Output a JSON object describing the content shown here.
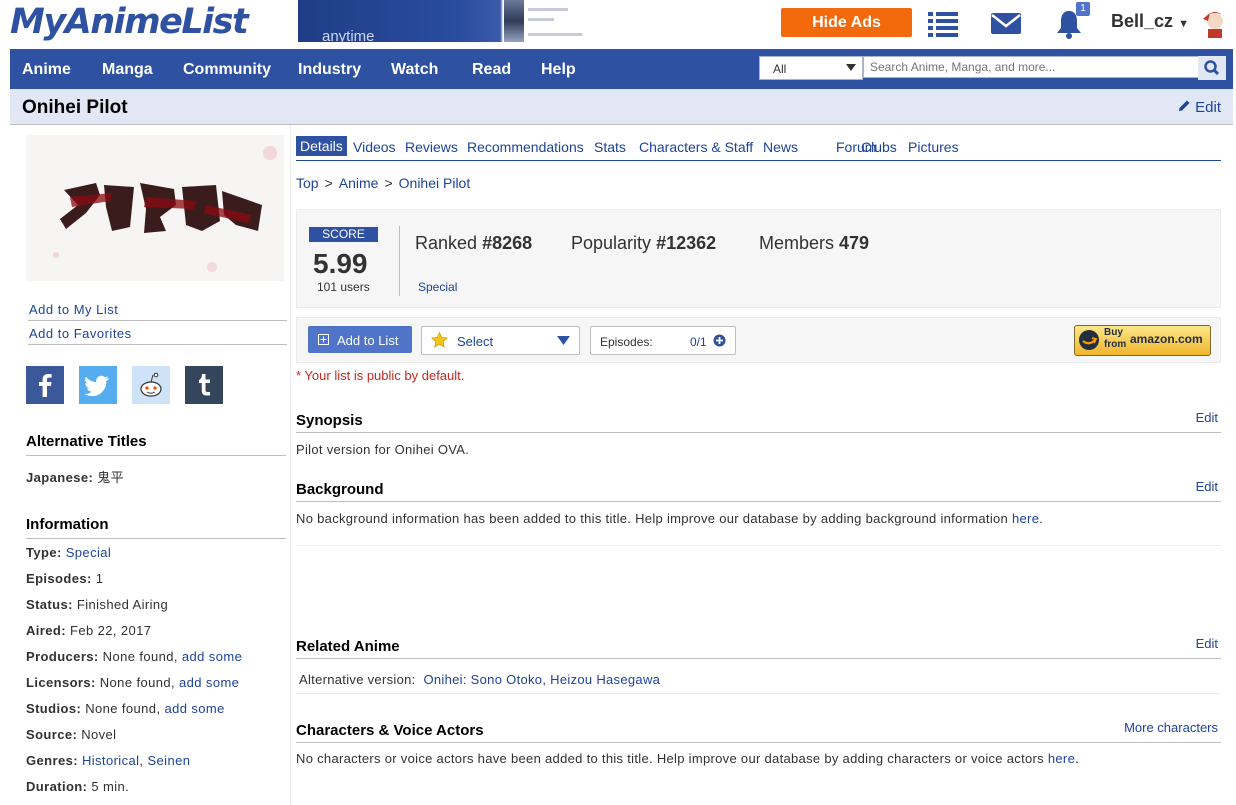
{
  "header": {
    "logo": "MyAnimeList",
    "ad_text": "anytime",
    "hide_ads_label": "Hide Ads",
    "username": "Bell_cz",
    "notification_count": "1"
  },
  "nav": {
    "items": [
      "Anime",
      "Manga",
      "Community",
      "Industry",
      "Watch",
      "Read",
      "Help"
    ],
    "search_category": "All",
    "search_placeholder": "Search Anime, Manga, and more..."
  },
  "page": {
    "title": "Onihei Pilot",
    "edit_label": "Edit"
  },
  "sidebar": {
    "add_to_list": "Add to My List",
    "add_to_favorites": "Add to Favorites",
    "share": [
      "facebook-icon",
      "twitter-icon",
      "reddit-icon",
      "tumblr-icon"
    ],
    "alt_titles_heading": "Alternative Titles",
    "japanese_label": "Japanese:",
    "japanese_value": "鬼平",
    "info_heading": "Information",
    "type_label": "Type:",
    "type_value": "Special",
    "episodes_label": "Episodes:",
    "episodes_value": "1",
    "status_label": "Status:",
    "status_value": "Finished Airing",
    "aired_label": "Aired:",
    "aired_value": "Feb 22, 2017",
    "producers_label": "Producers:",
    "producers_value": "None found,",
    "producers_link": "add some",
    "licensors_label": "Licensors:",
    "licensors_value": "None found,",
    "licensors_link": "add some",
    "studios_label": "Studios:",
    "studios_value": "None found,",
    "studios_link": "add some",
    "source_label": "Source:",
    "source_value": "Novel",
    "genres_label": "Genres:",
    "genre_1": "Historical",
    "genre_sep": ",",
    "genre_2": "Seinen",
    "duration_label": "Duration:",
    "duration_value": "5 min."
  },
  "tabs": [
    "Details",
    "Videos",
    "Reviews",
    "Recommendations",
    "Stats",
    "Characters & Staff",
    "News",
    "Forum",
    "Clubs",
    "Pictures"
  ],
  "breadcrumb": [
    "Top",
    "Anime",
    "Onihei Pilot"
  ],
  "breadcrumb_sep": ">",
  "score": {
    "label": "SCORE",
    "value": "5.99",
    "users": "101 users",
    "ranked_label": "Ranked",
    "ranked_value": "#8268",
    "popularity_label": "Popularity",
    "popularity_value": "#12362",
    "members_label": "Members",
    "members_value": "479",
    "type": "Special"
  },
  "list_controls": {
    "add_label": "Add to List",
    "status_label": "Select",
    "episodes_label": "Episodes:",
    "episodes_value": "0/1",
    "amazon_buy": "Buy",
    "amazon_from": "from",
    "amazon_brand": "amazon.com",
    "public_note": "* Your list is public by default."
  },
  "synopsis": {
    "heading": "Synopsis",
    "edit": "Edit",
    "text": "Pilot version for Onihei OVA."
  },
  "background": {
    "heading": "Background",
    "edit": "Edit",
    "text": "No background information has been added to this title. Help improve our database by adding background information",
    "link": "here",
    "end": "."
  },
  "related": {
    "heading": "Related Anime",
    "edit": "Edit",
    "label": "Alternative version:",
    "link": "Onihei: Sono Otoko, Heizou Hasegawa"
  },
  "characters": {
    "heading": "Characters & Voice Actors",
    "more": "More characters",
    "text": "No characters or voice actors have been added to this title. Help improve our database by adding characters or voice actors",
    "link": "here",
    "end": "."
  },
  "colors": {
    "brand": "#2e51a2",
    "link": "#1d439b",
    "hide_ads": "#f26a0b",
    "note_red": "#c8281e"
  }
}
